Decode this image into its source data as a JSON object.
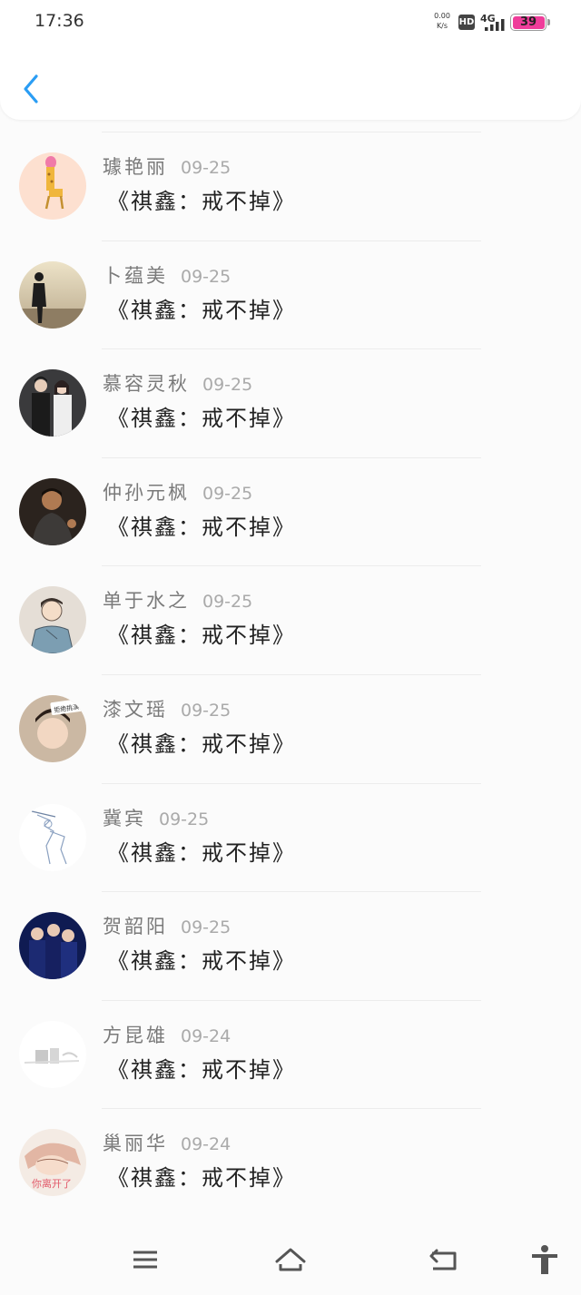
{
  "status": {
    "time": "17:36",
    "speed_value": "0.00",
    "speed_unit": "K/s",
    "hd": "HD",
    "network": "4G",
    "battery": "39"
  },
  "feed": [
    {
      "name": "璩艳丽",
      "date": "09-25",
      "title": "《祺鑫：戒不掉》"
    },
    {
      "name": "卜蕴美",
      "date": "09-25",
      "title": "《祺鑫：戒不掉》"
    },
    {
      "name": "慕容灵秋",
      "date": "09-25",
      "title": "《祺鑫：戒不掉》"
    },
    {
      "name": "仲孙元枫",
      "date": "09-25",
      "title": "《祺鑫：戒不掉》"
    },
    {
      "name": "单于水之",
      "date": "09-25",
      "title": "《祺鑫：戒不掉》"
    },
    {
      "name": "漆文瑶",
      "date": "09-25",
      "title": "《祺鑫：戒不掉》"
    },
    {
      "name": "冀宾",
      "date": "09-25",
      "title": "《祺鑫：戒不掉》"
    },
    {
      "name": "贺韶阳",
      "date": "09-25",
      "title": "《祺鑫：戒不掉》"
    },
    {
      "name": "方昆雄",
      "date": "09-24",
      "title": "《祺鑫：戒不掉》"
    },
    {
      "name": "巢丽华",
      "date": "09-24",
      "title": "《祺鑫：戒不掉》"
    }
  ],
  "avatar_text": {
    "item5": "拒绝挑演",
    "item9": "你离开了"
  },
  "colors": {
    "accent": "#2a9df4",
    "battery": "#ef3d9a"
  },
  "icons": {
    "back": "chevron-left-icon",
    "menu": "menu-icon",
    "home": "home-icon",
    "return": "return-icon",
    "accessibility": "accessibility-icon"
  }
}
